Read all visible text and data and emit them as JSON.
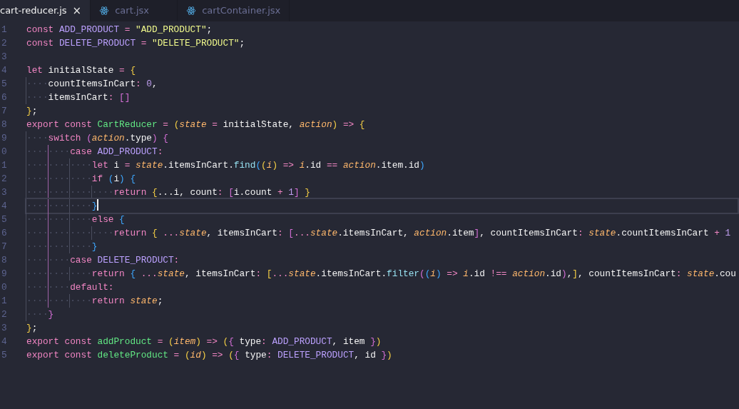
{
  "tabs": [
    {
      "label": "cart-reducer.js",
      "kind": "js",
      "selected": true,
      "close": "×"
    },
    {
      "label": "cart.jsx",
      "kind": "jsx",
      "selected": false
    },
    {
      "label": "cartContainer.jsx",
      "kind": "jsx",
      "selected": false
    }
  ],
  "lines": [
    {
      "number": "1",
      "active": false,
      "tokens": [
        {
          "t": "const ",
          "kind": "kw"
        },
        {
          "t": "ADD_PRODUCT ",
          "kind": "const"
        },
        {
          "t": "= ",
          "kind": "op"
        },
        {
          "t": "\"ADD_PRODUCT\"",
          "kind": "str"
        },
        {
          "t": ";",
          "kind": "id"
        }
      ]
    },
    {
      "number": "2",
      "active": false,
      "tokens": [
        {
          "t": "const ",
          "kind": "kw"
        },
        {
          "t": "DELETE_PRODUCT ",
          "kind": "const"
        },
        {
          "t": "= ",
          "kind": "op"
        },
        {
          "t": "\"DELETE_PRODUCT\"",
          "kind": "str"
        },
        {
          "t": ";",
          "kind": "id"
        }
      ]
    },
    {
      "number": "3",
      "active": false
    },
    {
      "number": "4",
      "active": false,
      "tokens": [
        {
          "t": "let ",
          "kind": "kw"
        },
        {
          "t": "initialState ",
          "kind": "id"
        },
        {
          "t": "= ",
          "kind": "op"
        },
        {
          "t": "{",
          "kind": "b1"
        }
      ]
    },
    {
      "number": "5",
      "active": false,
      "tokens": [
        {
          "t": "····",
          "kind": "ws"
        },
        {
          "t": "countItemsInCart",
          "kind": "id"
        },
        {
          "t": ": ",
          "kind": "op"
        },
        {
          "t": "0",
          "kind": "num"
        },
        {
          "t": ",",
          "kind": "id"
        }
      ]
    },
    {
      "number": "6",
      "active": false,
      "tokens": [
        {
          "t": "····",
          "kind": "ws"
        },
        {
          "t": "itemsInCart",
          "kind": "id"
        },
        {
          "t": ": ",
          "kind": "op"
        },
        {
          "t": "[]",
          "kind": "b2"
        }
      ]
    },
    {
      "number": "7",
      "active": false,
      "tokens": [
        {
          "t": "}",
          "kind": "b1"
        },
        {
          "t": ";",
          "kind": "id"
        }
      ]
    },
    {
      "number": "8",
      "active": false,
      "tokens": [
        {
          "t": "export ",
          "kind": "kw"
        },
        {
          "t": "const ",
          "kind": "kw"
        },
        {
          "t": "CartReducer ",
          "kind": "fn"
        },
        {
          "t": "= ",
          "kind": "op"
        },
        {
          "t": "(",
          "kind": "b1"
        },
        {
          "t": "state ",
          "kind": "param"
        },
        {
          "t": "= ",
          "kind": "op"
        },
        {
          "t": "initialState, ",
          "kind": "id"
        },
        {
          "t": "action",
          "kind": "param"
        },
        {
          "t": ") ",
          "kind": "b1"
        },
        {
          "t": "=> ",
          "kind": "op"
        },
        {
          "t": "{",
          "kind": "b1"
        }
      ]
    },
    {
      "number": "9",
      "active": false,
      "tokens": [
        {
          "t": "····",
          "kind": "ws"
        },
        {
          "t": "switch ",
          "kind": "kw"
        },
        {
          "t": "(",
          "kind": "b2"
        },
        {
          "t": "action",
          "kind": "param"
        },
        {
          "t": ".type",
          "kind": "id"
        },
        {
          "t": ") ",
          "kind": "b2"
        },
        {
          "t": "{",
          "kind": "b2"
        }
      ]
    },
    {
      "number": "0",
      "active": false,
      "tokens": [
        {
          "t": "········",
          "kind": "ws"
        },
        {
          "t": "case ",
          "kind": "kw"
        },
        {
          "t": "ADD_PRODUCT",
          "kind": "const"
        },
        {
          "t": ":",
          "kind": "op"
        }
      ]
    },
    {
      "number": "1",
      "active": false,
      "tokens": [
        {
          "t": "············",
          "kind": "ws"
        },
        {
          "t": "let ",
          "kind": "kw"
        },
        {
          "t": "i ",
          "kind": "id"
        },
        {
          "t": "= ",
          "kind": "op"
        },
        {
          "t": "state",
          "kind": "param"
        },
        {
          "t": ".itemsInCart.",
          "kind": "id"
        },
        {
          "t": "find",
          "kind": "method"
        },
        {
          "t": "(",
          "kind": "b3"
        },
        {
          "t": "(",
          "kind": "b1"
        },
        {
          "t": "i",
          "kind": "param"
        },
        {
          "t": ") ",
          "kind": "b1"
        },
        {
          "t": "=> ",
          "kind": "op"
        },
        {
          "t": "i",
          "kind": "param"
        },
        {
          "t": ".id ",
          "kind": "id"
        },
        {
          "t": "== ",
          "kind": "op"
        },
        {
          "t": "action",
          "kind": "param"
        },
        {
          "t": ".item.id",
          "kind": "id"
        },
        {
          "t": ")",
          "kind": "b3"
        }
      ]
    },
    {
      "number": "2",
      "active": false,
      "tokens": [
        {
          "t": "············",
          "kind": "ws"
        },
        {
          "t": "if ",
          "kind": "kw"
        },
        {
          "t": "(",
          "kind": "b3"
        },
        {
          "t": "i",
          "kind": "id"
        },
        {
          "t": ") ",
          "kind": "b3"
        },
        {
          "t": "{",
          "kind": "b3"
        }
      ]
    },
    {
      "number": "3",
      "active": false,
      "tokens": [
        {
          "t": "················",
          "kind": "ws"
        },
        {
          "t": "return ",
          "kind": "kw"
        },
        {
          "t": "{",
          "kind": "b1"
        },
        {
          "t": "...i, count",
          "kind": "id"
        },
        {
          "t": ": ",
          "kind": "op"
        },
        {
          "t": "[",
          "kind": "b2"
        },
        {
          "t": "i.count ",
          "kind": "id"
        },
        {
          "t": "+ ",
          "kind": "op"
        },
        {
          "t": "1",
          "kind": "num"
        },
        {
          "t": "] ",
          "kind": "b2"
        },
        {
          "t": "}",
          "kind": "b1"
        }
      ]
    },
    {
      "number": "4",
      "active": true,
      "tokens": [
        {
          "t": "············",
          "kind": "ws"
        },
        {
          "t": "}",
          "kind": "b3"
        }
      ]
    },
    {
      "number": "5",
      "active": false,
      "tokens": [
        {
          "t": "············",
          "kind": "ws"
        },
        {
          "t": "else ",
          "kind": "kw"
        },
        {
          "t": "{",
          "kind": "b3"
        }
      ]
    },
    {
      "number": "6",
      "active": false,
      "tokens": [
        {
          "t": "················",
          "kind": "ws"
        },
        {
          "t": "return ",
          "kind": "kw"
        },
        {
          "t": "{ ",
          "kind": "b1"
        },
        {
          "t": "...",
          "kind": "op"
        },
        {
          "t": "state",
          "kind": "param"
        },
        {
          "t": ", itemsInCart",
          "kind": "id"
        },
        {
          "t": ": ",
          "kind": "op"
        },
        {
          "t": "[",
          "kind": "b2"
        },
        {
          "t": "...",
          "kind": "op"
        },
        {
          "t": "state",
          "kind": "param"
        },
        {
          "t": ".itemsInCart, ",
          "kind": "id"
        },
        {
          "t": "action",
          "kind": "param"
        },
        {
          "t": ".item",
          "kind": "id"
        },
        {
          "t": "]",
          "kind": "b2"
        },
        {
          "t": ", countItemsInCart",
          "kind": "id"
        },
        {
          "t": ": ",
          "kind": "op"
        },
        {
          "t": "state",
          "kind": "param"
        },
        {
          "t": ".countItemsInCart ",
          "kind": "id"
        },
        {
          "t": "+ ",
          "kind": "op"
        },
        {
          "t": "1",
          "kind": "num"
        }
      ]
    },
    {
      "number": "7",
      "active": false,
      "tokens": [
        {
          "t": "············",
          "kind": "ws"
        },
        {
          "t": "}",
          "kind": "b3"
        }
      ]
    },
    {
      "number": "8",
      "active": false,
      "tokens": [
        {
          "t": "········",
          "kind": "ws"
        },
        {
          "t": "case ",
          "kind": "kw"
        },
        {
          "t": "DELETE_PRODUCT",
          "kind": "const"
        },
        {
          "t": ":",
          "kind": "op"
        }
      ]
    },
    {
      "number": "9",
      "active": false,
      "tokens": [
        {
          "t": "············",
          "kind": "ws"
        },
        {
          "t": "return ",
          "kind": "kw"
        },
        {
          "t": "{ ",
          "kind": "b3"
        },
        {
          "t": "...",
          "kind": "op"
        },
        {
          "t": "state",
          "kind": "param"
        },
        {
          "t": ", itemsInCart",
          "kind": "id"
        },
        {
          "t": ": ",
          "kind": "op"
        },
        {
          "t": "[",
          "kind": "b1"
        },
        {
          "t": "...",
          "kind": "op"
        },
        {
          "t": "state",
          "kind": "param"
        },
        {
          "t": ".itemsInCart.",
          "kind": "id"
        },
        {
          "t": "filter",
          "kind": "method"
        },
        {
          "t": "(",
          "kind": "b2"
        },
        {
          "t": "(",
          "kind": "b3"
        },
        {
          "t": "i",
          "kind": "param"
        },
        {
          "t": ") ",
          "kind": "b3"
        },
        {
          "t": "=> ",
          "kind": "op"
        },
        {
          "t": "i",
          "kind": "param"
        },
        {
          "t": ".id ",
          "kind": "id"
        },
        {
          "t": "!== ",
          "kind": "op"
        },
        {
          "t": "action",
          "kind": "param"
        },
        {
          "t": ".id",
          "kind": "id"
        },
        {
          "t": ")",
          "kind": "b2"
        },
        {
          "t": ",",
          "kind": "id"
        },
        {
          "t": "]",
          "kind": "b1"
        },
        {
          "t": ", countItemsInCart",
          "kind": "id"
        },
        {
          "t": ": ",
          "kind": "op"
        },
        {
          "t": "state",
          "kind": "param"
        },
        {
          "t": ".cou",
          "kind": "id"
        }
      ]
    },
    {
      "number": "0",
      "active": false,
      "tokens": [
        {
          "t": "········",
          "kind": "ws"
        },
        {
          "t": "default",
          "kind": "kw"
        },
        {
          "t": ":",
          "kind": "op"
        }
      ]
    },
    {
      "number": "1",
      "active": false,
      "tokens": [
        {
          "t": "············",
          "kind": "ws"
        },
        {
          "t": "return ",
          "kind": "kw"
        },
        {
          "t": "state",
          "kind": "param"
        },
        {
          "t": ";",
          "kind": "id"
        }
      ]
    },
    {
      "number": "2",
      "active": false,
      "tokens": [
        {
          "t": "····",
          "kind": "ws"
        },
        {
          "t": "}",
          "kind": "b2"
        }
      ]
    },
    {
      "number": "3",
      "active": false,
      "tokens": [
        {
          "t": "}",
          "kind": "b1"
        },
        {
          "t": ";",
          "kind": "id"
        }
      ]
    },
    {
      "number": "4",
      "active": false,
      "tokens": [
        {
          "t": "export ",
          "kind": "kw"
        },
        {
          "t": "const ",
          "kind": "kw"
        },
        {
          "t": "addProduct ",
          "kind": "fn"
        },
        {
          "t": "= ",
          "kind": "op"
        },
        {
          "t": "(",
          "kind": "b1"
        },
        {
          "t": "item",
          "kind": "param"
        },
        {
          "t": ") ",
          "kind": "b1"
        },
        {
          "t": "=> ",
          "kind": "op"
        },
        {
          "t": "(",
          "kind": "b1"
        },
        {
          "t": "{ ",
          "kind": "b2"
        },
        {
          "t": "type",
          "kind": "id"
        },
        {
          "t": ": ",
          "kind": "op"
        },
        {
          "t": "ADD_PRODUCT",
          "kind": "const"
        },
        {
          "t": ", item ",
          "kind": "id"
        },
        {
          "t": "}",
          "kind": "b2"
        },
        {
          "t": ")",
          "kind": "b1"
        }
      ]
    },
    {
      "number": "5",
      "active": false,
      "tokens": [
        {
          "t": "export ",
          "kind": "kw"
        },
        {
          "t": "const ",
          "kind": "kw"
        },
        {
          "t": "deleteProduct ",
          "kind": "fn"
        },
        {
          "t": "= ",
          "kind": "op"
        },
        {
          "t": "(",
          "kind": "b1"
        },
        {
          "t": "id",
          "kind": "param"
        },
        {
          "t": ") ",
          "kind": "b1"
        },
        {
          "t": "=> ",
          "kind": "op"
        },
        {
          "t": "(",
          "kind": "b1"
        },
        {
          "t": "{ ",
          "kind": "b2"
        },
        {
          "t": "type",
          "kind": "id"
        },
        {
          "t": ": ",
          "kind": "op"
        },
        {
          "t": "DELETE_PRODUCT",
          "kind": "const"
        },
        {
          "t": ", id ",
          "kind": "id"
        },
        {
          "t": "}",
          "kind": "b2"
        },
        {
          "t": ")",
          "kind": "b1"
        }
      ]
    }
  ]
}
